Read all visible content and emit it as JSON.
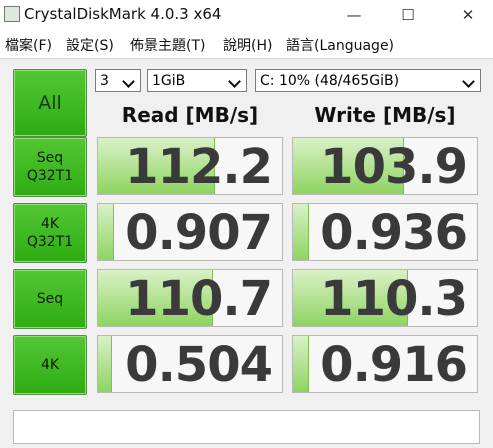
{
  "window": {
    "title": "CrystalDiskMark 4.0.3 x64",
    "minimize": "—",
    "maximize": "☐",
    "close": "✕"
  },
  "menu": [
    "檔案(F)",
    "設定(S)",
    "佈景主題(T)",
    "說明(H)",
    "語言(Language)"
  ],
  "toolbar": {
    "all_label": "All",
    "runs": "3",
    "size": "1GiB",
    "drive": "C: 10% (48/465GiB)"
  },
  "headers": {
    "read": "Read [MB/s]",
    "write": "Write [MB/s]"
  },
  "tests": [
    {
      "label": "Seq\nQ32T1",
      "read": "112.2",
      "write": "103.9",
      "read_level": 0.63,
      "write_level": 0.6
    },
    {
      "label": "4K\nQ32T1",
      "read": "0.907",
      "write": "0.936",
      "read_level": 0.08,
      "write_level": 0.08
    },
    {
      "label": "Seq",
      "read": "110.7",
      "write": "110.3",
      "read_level": 0.62,
      "write_level": 0.62
    },
    {
      "label": "4K",
      "read": "0.504",
      "write": "0.916",
      "read_level": 0.07,
      "write_level": 0.08
    }
  ],
  "colors": {
    "button_green": "#2eac12",
    "bar_green": "#8ed460"
  }
}
